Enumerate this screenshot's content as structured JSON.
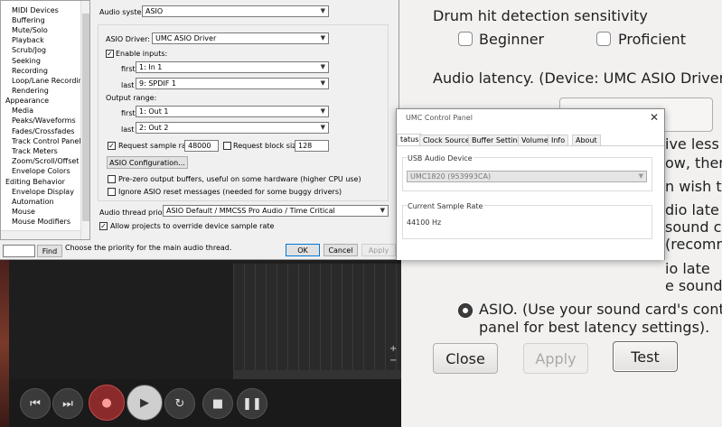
{
  "drum_app": {
    "sensitivity_label": "Drum hit detection sensitivity",
    "beginner_label": "Beginner",
    "proficient_label": "Proficient",
    "latency_label": "Audio latency.  (Device: UMC ASIO Driver",
    "partial_lines": [
      "ive less",
      "ow, ther",
      "n wish to",
      "dio late",
      "sound ca",
      "(recomm",
      "io late",
      "e sound"
    ],
    "asio_line1": "ASIO. (Use your sound card's contr",
    "asio_line2": "panel for best latency settings).",
    "close_label": "Close",
    "apply_label": "Apply",
    "test_label": "Test"
  },
  "prefs": {
    "tree_items": [
      "MIDI Devices",
      "Buffering",
      "Mute/Solo",
      "Playback",
      "Scrub/Jog",
      "Seeking",
      "Recording",
      "Loop/Lane Recording",
      "Rendering",
      "Appearance",
      "Media",
      "Peaks/Waveforms",
      "Fades/Crossfades",
      "Track Control Panels",
      "Track Meters",
      "Zoom/Scroll/Offset",
      "Envelope Colors",
      "Editing Behavior",
      "Envelope Display",
      "Automation",
      "Mouse",
      "Mouse Modifiers"
    ],
    "find_label": "Find",
    "hint_text": "Choose the priority for the main audio thread.",
    "audio_system_label": "Audio system:",
    "audio_system_value": "ASIO",
    "asio_driver_label": "ASIO Driver:",
    "asio_driver_value": "UMC ASIO Driver",
    "enable_inputs_label": "Enable inputs:",
    "first_label": "first",
    "last_label": "last",
    "input_first": "1: In 1",
    "input_last": "9: SPDIF 1",
    "output_range_label": "Output range:",
    "output_first": "1: Out 1",
    "output_last": "2: Out 2",
    "request_rate_label": "Request sample rate:",
    "request_rate_value": "48000",
    "request_block_label": "Request block size:",
    "request_block_value": "128",
    "asio_config_label": "ASIO Configuration...",
    "prezero_label": "Pre-zero output buffers, useful on some hardware (higher CPU use)",
    "ignore_reset_label": "Ignore ASIO reset messages (needed for some buggy drivers)",
    "thread_priority_label": "Audio thread priority:",
    "thread_priority_value": "ASIO Default / MMCSS Pro Audio / Time Critical",
    "allow_override_label": "Allow projects to override device sample rate",
    "ok_label": "OK",
    "cancel_label": "Cancel",
    "apply_label": "Apply"
  },
  "umc": {
    "title": "UMC Control Panel",
    "tabs": [
      "tatus",
      "Clock Source",
      "Buffer Settings",
      "Volume",
      "Info",
      "About"
    ],
    "usb_device_label": "USB Audio Device",
    "usb_device_value": "UMC1820 (953993CA)",
    "sample_rate_label": "Current Sample Rate",
    "sample_rate_value": "44100 Hz"
  }
}
